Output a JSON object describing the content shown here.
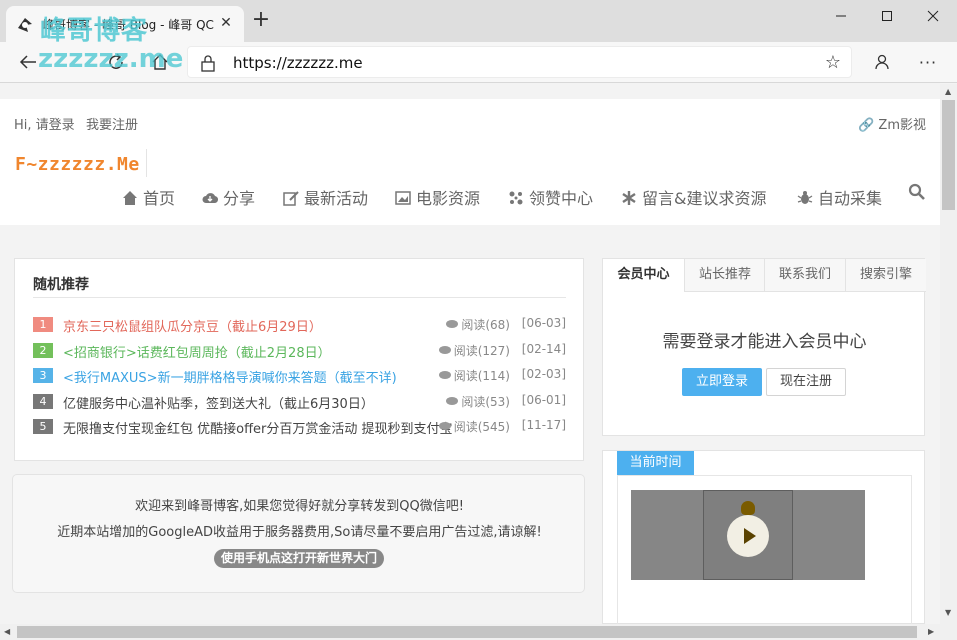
{
  "browser": {
    "tab_title": "峰哥博客 - 峰哥 Blog - 峰哥 QC",
    "url": "https://zzzzzz.me",
    "watermark_line1": "峰哥博客",
    "watermark_line2": "zzzzzz.me"
  },
  "header": {
    "login": "Hi, 请登录",
    "register": "我要注册",
    "zm": "Zm影视",
    "logo": "F~zzzzzz.Me"
  },
  "nav": [
    {
      "label": "首页",
      "icon": "home-icon"
    },
    {
      "label": "分享",
      "icon": "cloud-download-icon"
    },
    {
      "label": "最新活动",
      "icon": "edit-icon"
    },
    {
      "label": "电影资源",
      "icon": "picture-icon"
    },
    {
      "label": "领赞中心",
      "icon": "pinwheel-icon"
    },
    {
      "label": "留言&建议求资源",
      "icon": "asterisk-icon"
    },
    {
      "label": "自动采集",
      "icon": "bug-icon"
    }
  ],
  "random": {
    "title": "随机推荐",
    "items": [
      {
        "num": "1",
        "title": "京东三只松鼠组队瓜分京豆（截止6月29日）",
        "views": "阅读(68)",
        "date": "[06-03]",
        "color": "#e2675a",
        "badge": "#f08b80"
      },
      {
        "num": "2",
        "title": "<招商银行>话费红包周周抢（截止2月28日）",
        "views": "阅读(127)",
        "date": "[02-14]",
        "color": "#5bb75b",
        "badge": "#73c05b"
      },
      {
        "num": "3",
        "title": "<我行MAXUS>新一期胖格格导演喊你来答题（截至不详)",
        "views": "阅读(114)",
        "date": "[02-03]",
        "color": "#3aa3e3",
        "badge": "#56b3e8"
      },
      {
        "num": "4",
        "title": "亿健服务中心温补贴季，签到送大礼（截止6月30日）",
        "views": "阅读(53)",
        "date": "[06-01]",
        "color": "#444444",
        "badge": "#777777"
      },
      {
        "num": "5",
        "title": "无限撸支付宝现金红包 优酷接offer分百万赏金活动 提现秒到支付宝",
        "views": "阅读(545)",
        "date": "[11-17]",
        "color": "#444444",
        "badge": "#777777"
      }
    ]
  },
  "welcome": {
    "line1": "欢迎来到峰哥博客,如果您觉得好就分享转发到QQ微信吧!",
    "line2": "近期本站增加的GoogleAD收益用于服务器费用,So请尽量不要启用广告过滤,请谅解!",
    "button": "使用手机点这打开新世界大门"
  },
  "member": {
    "tabs": [
      "会员中心",
      "站长推荐",
      "联系我们",
      "搜索引擎"
    ],
    "message": "需要登录才能进入会员中心",
    "login_btn": "立即登录",
    "register_btn": "现在注册"
  },
  "time": {
    "label": "当前时间"
  },
  "colors": {
    "accent_blue": "#4db0ef",
    "logo_orange": "#f0862e"
  }
}
